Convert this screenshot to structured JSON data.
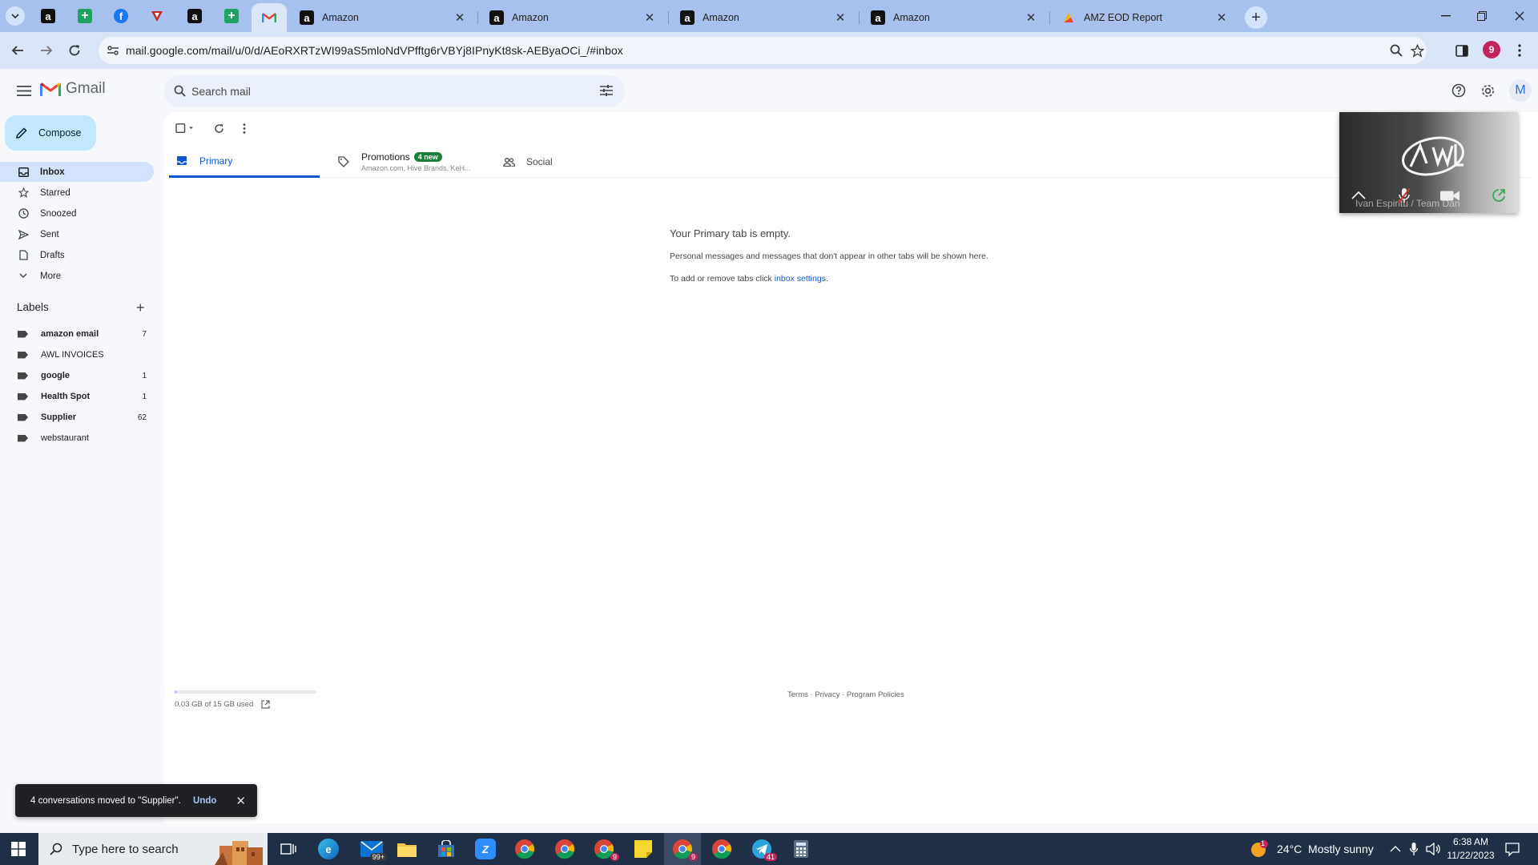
{
  "browser": {
    "tabs": [
      {
        "title": "Amazon"
      },
      {
        "title": "Amazon"
      },
      {
        "title": "Amazon"
      },
      {
        "title": "Amazon"
      },
      {
        "title": "AMZ EOD Report"
      }
    ],
    "url": "mail.google.com/mail/u/0/d/AEoRXRTzWI99aS5mloNdVPfftg6rVBYj8IPnyKt8sk-AEByaOCi_/#inbox",
    "profile_initial": "9"
  },
  "gmail": {
    "wordmark": "Gmail",
    "search_placeholder": "Search mail",
    "account_initial": "M",
    "compose": "Compose",
    "nav": [
      {
        "label": "Inbox"
      },
      {
        "label": "Starred"
      },
      {
        "label": "Snoozed"
      },
      {
        "label": "Sent"
      },
      {
        "label": "Drafts"
      },
      {
        "label": "More"
      }
    ],
    "labels_header": "Labels",
    "labels": [
      {
        "name": "amazon email",
        "count": "7",
        "bold": true
      },
      {
        "name": "AWL INVOICES",
        "count": "",
        "bold": false
      },
      {
        "name": "google",
        "count": "1",
        "bold": true
      },
      {
        "name": "Health Spot",
        "count": "1",
        "bold": true
      },
      {
        "name": "Supplier",
        "count": "62",
        "bold": true
      },
      {
        "name": "webstaurant",
        "count": "",
        "bold": false
      }
    ],
    "tabs": {
      "primary": "Primary",
      "promotions": "Promotions",
      "promotions_badge": "4 new",
      "promotions_senders": "Amazon.com, Hive Brands, KeH...",
      "social": "Social"
    },
    "empty": {
      "title": "Your Primary tab is empty.",
      "line1": "Personal messages and messages that don't appear in other tabs will be shown here.",
      "line2_prefix": "To add or remove tabs click ",
      "line2_link": "inbox settings",
      "line2_suffix": "."
    },
    "storage": {
      "text": "0.03 GB of 15 GB used",
      "fraction": 0.002
    },
    "footer": "Terms · Privacy · Program Policies",
    "snackbar": {
      "message": "4 conversations moved to \"Supplier\".",
      "action": "Undo"
    }
  },
  "meet_pip": {
    "caption": "Ivan Espiritu / Team Dan"
  },
  "taskbar": {
    "search_placeholder": "Type here to search",
    "mail_badge": "99+",
    "chrome_badge_1": "9",
    "chrome_badge_2": "9",
    "telegram_badge": "41",
    "weather": "24°C  Mostly sunny",
    "weather_badge": "1",
    "time": "6:38 AM",
    "date": "11/22/2023"
  },
  "colors": {
    "accent": "#0b57d0",
    "compose_bg": "#c2e7ff",
    "nav_active_bg": "#d3e3fd",
    "tabbar_bg": "#a8c0ee"
  }
}
